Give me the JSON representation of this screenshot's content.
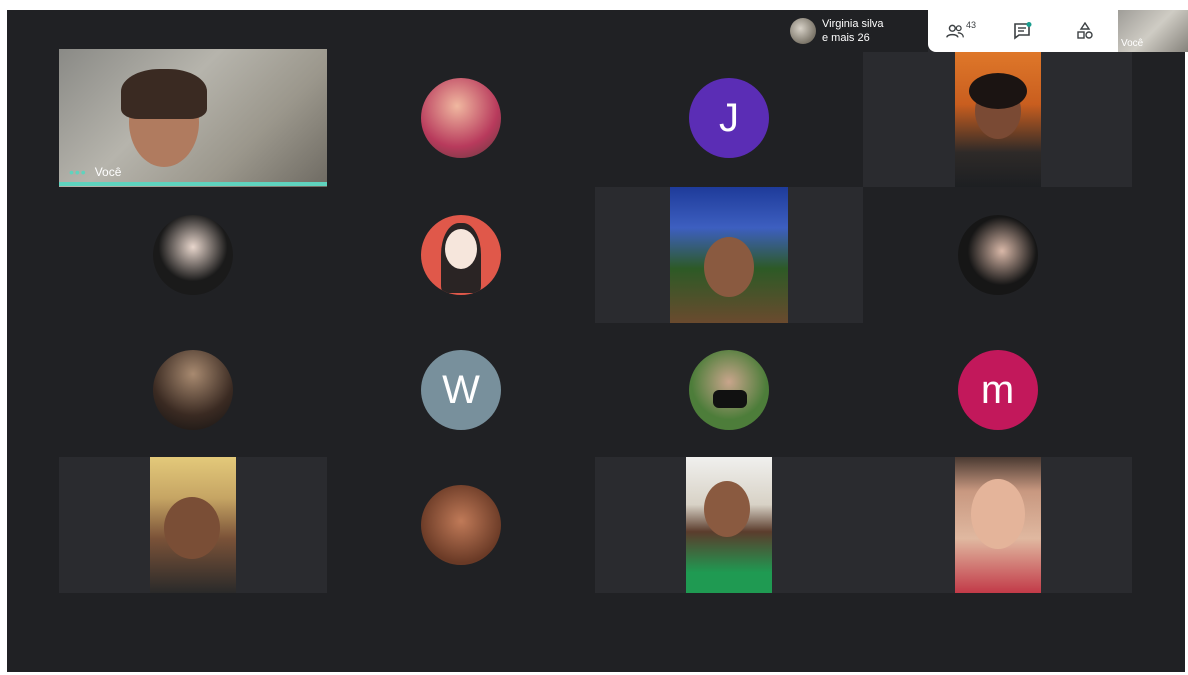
{
  "self": {
    "label": "Você"
  },
  "presenter": {
    "name": "Virginia silva",
    "more": "e mais 26"
  },
  "toolbar": {
    "people_count": "43"
  },
  "tiles": [
    {
      "letter": "J",
      "color": "#5b2db5"
    },
    {
      "letter": "W",
      "color": "#78909c"
    },
    {
      "letter": "m",
      "color": "#c2185b"
    }
  ]
}
